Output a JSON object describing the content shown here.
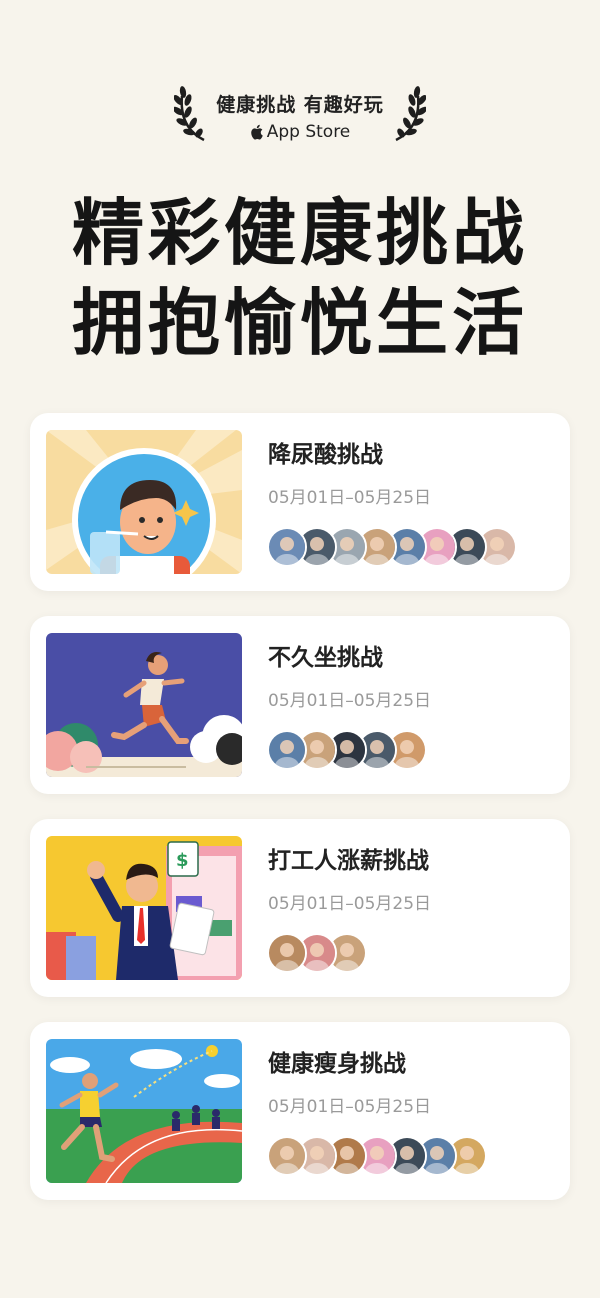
{
  "badge": {
    "title": "健康挑战 有趣好玩",
    "store": "App Store",
    "icon": "apple-icon"
  },
  "headline": {
    "line1": "精彩健康挑战",
    "line2": "拥抱愉悦生活"
  },
  "challenges": [
    {
      "title": "降尿酸挑战",
      "date": "05月01日–05月25日",
      "illustration": "boy-drinking-water",
      "participants": [
        "#6b8bb5",
        "#4a5a6a",
        "#9aa6b0",
        "#c9a27a",
        "#5b7fa8",
        "#e8a0c0",
        "#3c4a58",
        "#d9b8a8"
      ]
    },
    {
      "title": "不久坐挑战",
      "date": "05月01日–05月25日",
      "illustration": "woman-running",
      "participants": [
        "#5b7fa8",
        "#c9a27a",
        "#2c3440",
        "#4a5a6a",
        "#d09a6a"
      ]
    },
    {
      "title": "打工人涨薪挑战",
      "date": "05月01日–05月25日",
      "illustration": "office-worker-cheering",
      "participants": [
        "#b88a60",
        "#d88a8a",
        "#c9a27a"
      ]
    },
    {
      "title": "健康瘦身挑战",
      "date": "05月01日–05月25日",
      "illustration": "runners-on-track",
      "participants": [
        "#c9a27a",
        "#d9b8a8",
        "#b07a4a",
        "#e8a0c0",
        "#3c4a58",
        "#5b7fa8",
        "#d4a860"
      ]
    }
  ]
}
